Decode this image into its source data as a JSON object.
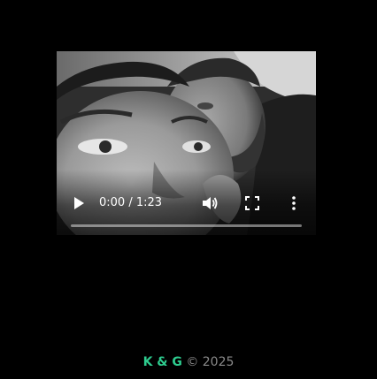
{
  "video": {
    "current_time": "0:00",
    "duration": "1:23",
    "time_separator": " / ",
    "progress_fraction": 0
  },
  "footer": {
    "brand": "K & G",
    "copyright": "© 2025"
  },
  "colors": {
    "background": "#000000",
    "brand": "#2ecc8f",
    "copyright": "#8a8a8a",
    "controls": "#ffffff"
  },
  "icons": {
    "play": "play-icon",
    "volume": "volume-icon",
    "fullscreen": "fullscreen-icon",
    "menu": "more-vert-icon"
  }
}
